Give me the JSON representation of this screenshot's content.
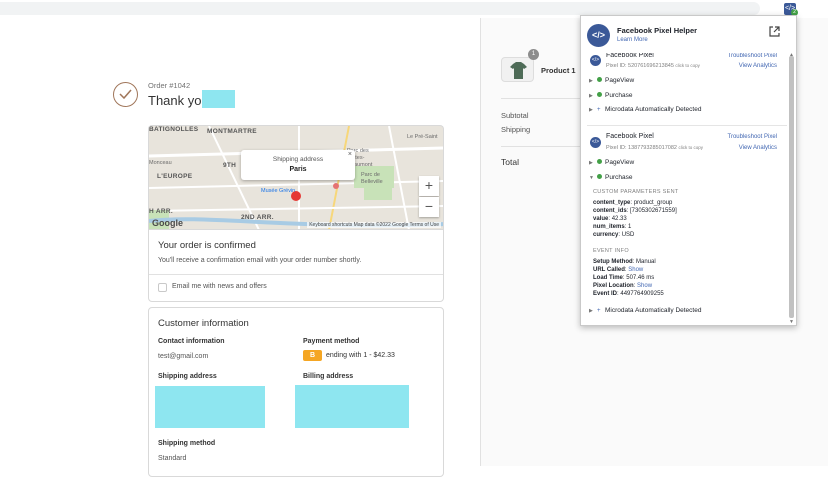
{
  "order": {
    "number": "Order #1042",
    "thanks": "Thank you",
    "confirmed_title": "Your order is confirmed",
    "confirmed_text": "You'll receive a confirmation email with your order number shortly.",
    "news_label": "Email me with news and offers"
  },
  "map": {
    "labels": [
      "MONTMARTRE",
      "9TH",
      "L'EUROPE",
      "H ARR.",
      "2ND ARR.",
      "Le Pré-Saint",
      "Parc des Buttes-Chaumont",
      "Parc de Belleville",
      "Musée Grévin",
      "Monceau",
      "BATIGNOLLES"
    ],
    "popup_title": "Shipping address",
    "popup_city": "Paris",
    "popup_close": "×",
    "zoom_in": "+",
    "zoom_out": "−",
    "google": "Google",
    "footer": "Keyboard shortcuts   Map data ©2022 Google   Terms of Use"
  },
  "customer": {
    "title": "Customer information",
    "contact_label": "Contact information",
    "contact_value": "test@gmail.com",
    "payment_label": "Payment method",
    "payment_badge": "B",
    "payment_value": "ending with 1 - $42.33",
    "shipping_label": "Shipping address",
    "billing_label": "Billing address",
    "method_label": "Shipping method",
    "method_value": "Standard"
  },
  "summary": {
    "qty": "1",
    "product": "Product 1",
    "subtotal": "Subtotal",
    "shipping": "Shipping",
    "total": "Total"
  },
  "ext": {
    "title": "Facebook Pixel Helper",
    "learn": "Learn More",
    "pixels": [
      {
        "name": "Facebook Pixel",
        "id": "Pixel ID: 520761696213845",
        "copy": "click to copy",
        "troubleshoot": "Troubleshoot Pixel",
        "analytics": "View Analytics",
        "events": [
          "PageView",
          "Purchase",
          "Microdata Automatically Detected"
        ]
      },
      {
        "name": "Facebook Pixel",
        "id": "Pixel ID: 1387793285017082",
        "copy": "click to copy",
        "troubleshoot": "Troubleshoot Pixel",
        "analytics": "View Analytics",
        "events": [
          "PageView",
          "Purchase",
          "Microdata Automatically Detected"
        ]
      }
    ],
    "custom_header": "CUSTOM PARAMETERS SENT",
    "params": [
      {
        "k": "content_type",
        "v": "product_group"
      },
      {
        "k": "content_ids",
        "v": "[7305302671559]"
      },
      {
        "k": "value",
        "v": "42.33"
      },
      {
        "k": "num_items",
        "v": "1"
      },
      {
        "k": "currency",
        "v": "USD"
      }
    ],
    "event_header": "EVENT INFO",
    "info": [
      {
        "k": "Setup Method",
        "v": "Manual"
      },
      {
        "k": "URL Called",
        "v": "Show"
      },
      {
        "k": "Load Time",
        "v": "507.46 ms"
      },
      {
        "k": "Pixel Location",
        "v": "Show"
      },
      {
        "k": "Event ID",
        "v": "4497764909255"
      }
    ]
  }
}
